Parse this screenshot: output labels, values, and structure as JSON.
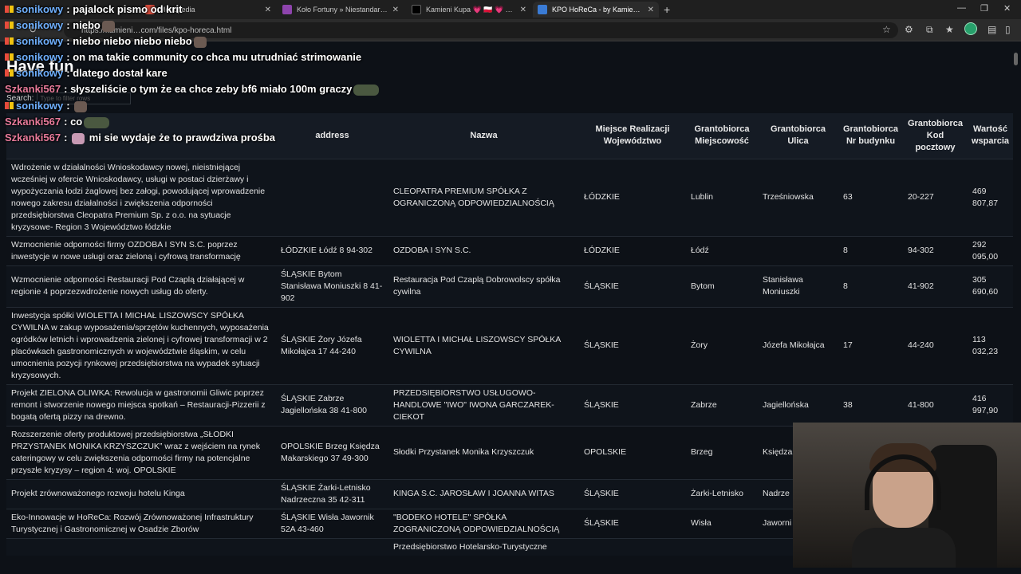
{
  "browser": {
    "tabs": [
      {
        "title": "",
        "active": false,
        "color": "#5b9bd5"
      },
      {
        "title": "Monopedia",
        "active": false,
        "color": "#d24b3b"
      },
      {
        "title": "Koło Fortuny » Niestandardowy W",
        "active": false,
        "color": "#8e44ad"
      },
      {
        "title": "Kamieni Kupa 💗 🇵🇱 💗 on X: \"Po",
        "active": false,
        "color": "#000000"
      },
      {
        "title": "KPO HoReCa - by KamieniKupa.co",
        "active": true,
        "color": "#3a7bd5"
      }
    ],
    "url": "https://kamieni…com/files/kpo-horeca.html"
  },
  "page": {
    "title": "Have fun",
    "search_label": "Search:",
    "search_placeholder": "Type to filter rows"
  },
  "table": {
    "columns": [
      "",
      "address",
      "Nazwa",
      "Miejsce Realizacji Województwo",
      "Grantobiorca Miejscowość",
      "Grantobiorca Ulica",
      "Grantobiorca Nr budynku",
      "Grantobiorca Kod pocztowy",
      "Wartość wsparcia"
    ],
    "rows": [
      [
        "Wdrożenie w działalności Wnioskodawcy nowej, nieistniejącej wcześniej w ofercie Wnioskodawcy, usługi w postaci dzierżawy i wypożyczania łodzi żaglowej bez załogi, powodującej wprowadzenie nowego zakresu działalności i zwiększenia odporności przedsiębiorstwa Cleopatra Premium Sp. z o.o. na sytuacje kryzysowe- Region 3 Województwo łódzkie",
        "",
        "CLEOPATRA PREMIUM SPÓŁKA Z OGRANICZONĄ ODPOWIEDZIALNOŚCIĄ",
        "ŁÓDZKIE",
        "Lublin",
        "Trześniowska",
        "63",
        "20-227",
        "469 807,87"
      ],
      [
        "Wzmocnienie odporności firmy OZDOBA I SYN S.C. poprzez inwestycje w nowe usługi oraz zieloną i cyfrową transformację",
        "ŁÓDZKIE Łódź 8 94-302",
        "OZDOBA I SYN S.C.",
        "ŁÓDZKIE",
        "Łódź",
        "",
        "8",
        "94-302",
        "292 095,00"
      ],
      [
        "Wzmocnienie odporności Restauracji Pod Czaplą działającej w regionie 4 poprzezwdrożenie nowych usług do oferty.",
        "ŚLĄSKIE Bytom Stanisława Moniuszki 8 41-902",
        "Restauracja Pod Czaplą Dobrowolscy spółka cywilna",
        "ŚLĄSKIE",
        "Bytom",
        "Stanisława Moniuszki",
        "8",
        "41-902",
        "305 690,60"
      ],
      [
        "Inwestycja spółki WIOLETTA I MICHAŁ LISZOWSCY SPÓŁKA CYWILNA w zakup wyposażenia/sprzętów kuchennych, wyposażenia ogródków letnich i wprowadzenia zielonej i cyfrowej transformacji w 2 placówkach gastronomicznych w województwie śląskim, w celu umocnienia pozycji rynkowej przedsiębiorstwa na wypadek sytuacji kryzysowych.",
        "ŚLĄSKIE Żory Józefa Mikołajca 17 44-240",
        "WIOLETTA I MICHAŁ LISZOWSCY SPÓŁKA CYWILNA",
        "ŚLĄSKIE",
        "Żory",
        "Józefa Mikołajca",
        "17",
        "44-240",
        "113 032,23"
      ],
      [
        "Projekt ZIELONA OLIWKA: Rewolucja w gastronomii Gliwic poprzez remont i stworzenie nowego miejsca spotkań – Restauracji-Pizzerii z bogatą ofertą pizzy na drewno.",
        "ŚLĄSKIE Zabrze Jagiellońska 38 41-800",
        "PRZEDSIĘBIORSTWO USŁUGOWO-HANDLOWE \"IWO\" IWONA GARCZAREK-CIEKOT",
        "ŚLĄSKIE",
        "Zabrze",
        "Jagiellońska",
        "38",
        "41-800",
        "416 997,90"
      ],
      [
        "Rozszerzenie oferty produktowej przedsiębiorstwa „SŁODKI PRZYSTANEK MONIKA KRZYSZCZUK” wraz z wejściem na rynek cateringowy w celu zwiększenia odporności firmy na potencjalne przyszłe kryzysy – region 4: woj. OPOLSKIE",
        "OPOLSKIE Brzeg Księdza Makarskiego 37 49-300",
        "Słodki Przystanek Monika Krzyszczuk",
        "OPOLSKIE",
        "Brzeg",
        "Księdza Makarski",
        "",
        "",
        ""
      ],
      [
        "Projekt zrównoważonego rozwoju hotelu Kinga",
        "ŚLĄSKIE Żarki-Letnisko Nadrzeczna 35 42-311",
        "KINGA S.C. JAROSŁAW I JOANNA WITAS",
        "ŚLĄSKIE",
        "Żarki-Letnisko",
        "Nadrze",
        "",
        "",
        ""
      ],
      [
        "Eko-Innowacje w HoReCa: Rozwój Zrównoważonej Infrastruktury Turystycznej i Gastronomicznej w Osadzie Zborów",
        "ŚLĄSKIE Wisła Jawornik 52A 43-460",
        "\"BODEKO HOTELE\" SPÓŁKA ZOGRANICZONĄ ODPOWIEDZIALNOŚCIĄ",
        "ŚLĄSKIE",
        "Wisła",
        "Jaworni",
        "",
        "",
        ""
      ],
      [
        "",
        "",
        "Przedsiębiorstwo Hotelarsko-Turystyczne",
        "",
        "",
        "",
        "",
        "",
        ""
      ]
    ]
  },
  "chat": [
    {
      "user": "sonikowy",
      "color": "#6fb0ff",
      "text": "pajalock pismo od krit"
    },
    {
      "user": "sonikowy",
      "color": "#6fb0ff",
      "text": "niebo"
    },
    {
      "user": "sonikowy",
      "color": "#6fb0ff",
      "text": "niebo niebo niebo niebo"
    },
    {
      "user": "sonikowy",
      "color": "#6fb0ff",
      "text": "on ma takie community co chca mu utrudniać strimowanie"
    },
    {
      "user": "sonikowy",
      "color": "#6fb0ff",
      "text": "dlatego dostał kare"
    },
    {
      "user": "Szkanki567",
      "color": "#e87a9a",
      "text": "słyszeliście o tym że ea chce zeby bf6 miało 100m graczy"
    },
    {
      "user": "sonikowy",
      "color": "#6fb0ff",
      "text": ""
    },
    {
      "user": "Szkanki567",
      "color": "#e87a9a",
      "text": "co"
    },
    {
      "user": "Szkanki567",
      "color": "#e87a9a",
      "text": "mi sie wydaje że to prawdziwa prośba"
    }
  ]
}
